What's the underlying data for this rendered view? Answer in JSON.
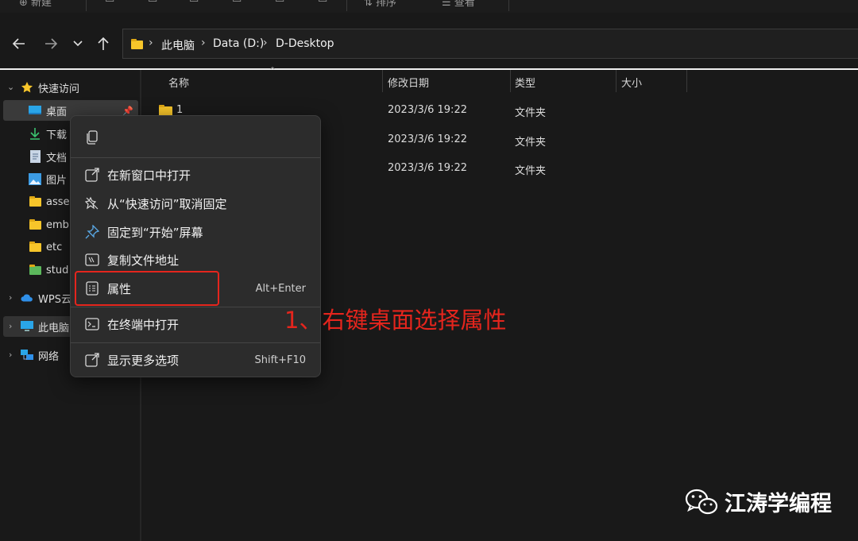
{
  "toolbar": {
    "new_label": "新建",
    "sort_label": "排序",
    "view_label": "查看"
  },
  "nav": {
    "breadcrumb": [
      "此电脑",
      "Data (D:)",
      "D-Desktop"
    ]
  },
  "sidebar": {
    "quick_access": "快速访问",
    "items": [
      {
        "label": "桌面",
        "icon": "desktop-icon",
        "pinned": true
      },
      {
        "label": "下载",
        "icon": "download-icon"
      },
      {
        "label": "文档",
        "icon": "document-icon"
      },
      {
        "label": "图片",
        "icon": "pictures-icon"
      },
      {
        "label": "asse",
        "icon": "folder-icon"
      },
      {
        "label": "emb",
        "icon": "folder-icon"
      },
      {
        "label": "etc",
        "icon": "folder-icon"
      },
      {
        "label": "stud",
        "icon": "folder-icon"
      }
    ],
    "wps": "WPS云",
    "this_pc": "此电脑",
    "network": "网络"
  },
  "filelist": {
    "columns": [
      "名称",
      "修改日期",
      "类型",
      "大小"
    ],
    "rows": [
      {
        "name": "1",
        "date": "2023/3/6 19:22",
        "type": "文件夹"
      },
      {
        "name": "",
        "date": "2023/3/6 19:22",
        "type": "文件夹"
      },
      {
        "name": "",
        "date": "2023/3/6 19:22",
        "type": "文件夹"
      }
    ]
  },
  "context_menu": {
    "items": [
      {
        "label": "在新窗口中打开",
        "icon": "open-new-window-icon",
        "shortcut": ""
      },
      {
        "label": "从“快速访问”取消固定",
        "icon": "unpin-icon",
        "shortcut": ""
      },
      {
        "label": "固定到“开始”屏幕",
        "icon": "pin-icon",
        "shortcut": ""
      },
      {
        "label": "复制文件地址",
        "icon": "copy-path-icon",
        "shortcut": ""
      },
      {
        "label": "属性",
        "icon": "properties-icon",
        "shortcut": "Alt+Enter"
      },
      {
        "label": "在终端中打开",
        "icon": "terminal-icon",
        "shortcut": ""
      },
      {
        "label": "显示更多选项",
        "icon": "more-options-icon",
        "shortcut": "Shift+F10"
      }
    ]
  },
  "annotation": "1、右键桌面选择属性",
  "watermark": "江涛学编程",
  "colors": {
    "accent_red": "#e5251d",
    "folder": "#f7c52a",
    "background": "#191919",
    "menu": "#2c2c2c"
  }
}
